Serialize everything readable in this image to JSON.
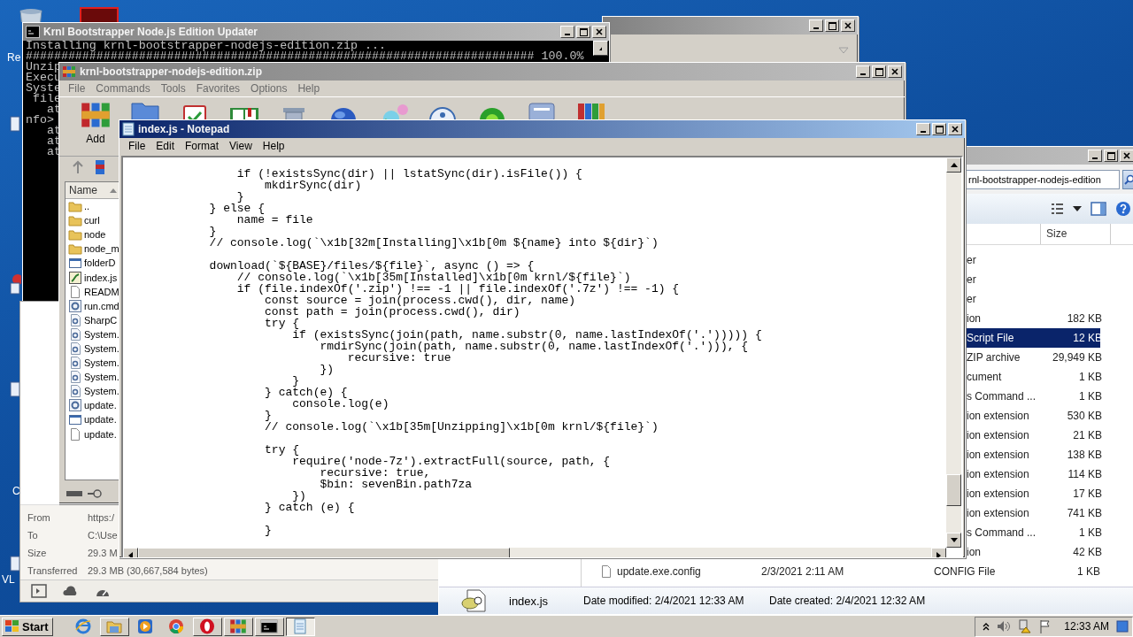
{
  "desktop": {
    "labels": [
      "Re",
      "C",
      "VL"
    ]
  },
  "console": {
    "title": "Krnl Bootstrapper Node.js Edition Updater",
    "lines": [
      "Installing krnl-bootstrapper-nodejs-edition.zip ...",
      "######################################################################## 100.0%",
      "Unzip",
      "Execu",
      "Syste",
      " file",
      "   at",
      "nfo>",
      "   at",
      "   at",
      "   at"
    ]
  },
  "download_panel": {
    "fields": [
      {
        "label": "From",
        "value": "https:/"
      },
      {
        "label": "To",
        "value": "C:\\Use"
      },
      {
        "label": "Size",
        "value": "29.3 M"
      },
      {
        "label": "Transferred",
        "value": "29.3 MB (30,667,584 bytes)"
      }
    ]
  },
  "explorer": {
    "address": "rnl-bootstrapper-nodejs-edition",
    "columns": [
      "Size"
    ],
    "rows": [
      {
        "kind": "partial",
        "type": "er",
        "selected": false
      },
      {
        "kind": "partial",
        "type": "er",
        "selected": false
      },
      {
        "kind": "partial",
        "type": "er",
        "selected": false
      },
      {
        "kind": "partial",
        "type": "ion",
        "size": "182 KB",
        "selected": false
      },
      {
        "kind": "partial",
        "type": "Script File",
        "size": "12 KB",
        "selected": true
      },
      {
        "kind": "partial",
        "type": "ZIP archive",
        "size": "29,949 KB",
        "selected": false
      },
      {
        "kind": "partial",
        "type": "cument",
        "size": "1 KB",
        "selected": false
      },
      {
        "kind": "partial",
        "type": "s Command ...",
        "size": "1 KB",
        "selected": false
      },
      {
        "kind": "partial",
        "type": "ion extension",
        "size": "530 KB",
        "selected": false
      },
      {
        "kind": "partial",
        "type": "ion extension",
        "size": "21 KB",
        "selected": false
      },
      {
        "kind": "partial",
        "type": "ion extension",
        "size": "138 KB",
        "selected": false
      },
      {
        "kind": "partial",
        "type": "ion extension",
        "size": "114 KB",
        "selected": false
      },
      {
        "kind": "partial",
        "type": "ion extension",
        "size": "17 KB",
        "selected": false
      },
      {
        "kind": "partial",
        "type": "ion extension",
        "size": "741 KB",
        "selected": false
      },
      {
        "kind": "partial",
        "type": "s Command ...",
        "size": "1 KB",
        "selected": false
      },
      {
        "kind": "partial",
        "type": "ion",
        "size": "42 KB",
        "selected": false
      },
      {
        "kind": "full",
        "name": "update.exe.config",
        "date": "2/3/2021 2:11 AM",
        "type": "CONFIG File",
        "size": "1 KB",
        "selected": false
      }
    ],
    "details": {
      "name": "index.js",
      "modified": "Date modified: 2/4/2021 12:33 AM",
      "created": "Date created: 2/4/2021 12:32 AM"
    }
  },
  "winrar": {
    "title": "krnl-bootstrapper-nodejs-edition.zip",
    "menu": [
      "File",
      "Commands",
      "Tools",
      "Favorites",
      "Options",
      "Help"
    ],
    "toolbar_label": "Add",
    "list_header": "Name",
    "files": [
      {
        "kind": "folder",
        "name": ".."
      },
      {
        "kind": "folder",
        "name": "curl"
      },
      {
        "kind": "folder",
        "name": "node"
      },
      {
        "kind": "folder",
        "name": "node_m"
      },
      {
        "kind": "app",
        "name": "folderD"
      },
      {
        "kind": "script",
        "name": "index.js"
      },
      {
        "kind": "text",
        "name": "READM"
      },
      {
        "kind": "cmd",
        "name": "run.cmd"
      },
      {
        "kind": "dll",
        "name": "SharpC"
      },
      {
        "kind": "dll",
        "name": "System."
      },
      {
        "kind": "dll",
        "name": "System."
      },
      {
        "kind": "dll",
        "name": "System."
      },
      {
        "kind": "dll",
        "name": "System."
      },
      {
        "kind": "dll",
        "name": "System."
      },
      {
        "kind": "cmd",
        "name": "update."
      },
      {
        "kind": "app",
        "name": "update."
      },
      {
        "kind": "text",
        "name": "update."
      }
    ]
  },
  "notepad": {
    "title": "index.js - Notepad",
    "menu": [
      "File",
      "Edit",
      "Format",
      "View",
      "Help"
    ],
    "blocks": [
      [
        "                if (!existsSync(dir) || lstatSync(dir).isFile()) {",
        "                    mkdirSync(dir)",
        "                }",
        "            } else {",
        "                name = file",
        "            }",
        "            // console.log(`\\x1b[32m[Installing]\\x1b[0m ${name} into ${dir}`)"
      ],
      [
        "            download(`${BASE}/files/${file}`, async () => {",
        "                // console.log(`\\x1b[35m[Installed]\\x1b[0m krnl/${file}`)",
        "                if (file.indexOf('.zip') !== -1 || file.indexOf('.7z') !== -1) {",
        "                    const source = join(process.cwd(), dir, name)",
        "                    const path = join(process.cwd(), dir)",
        "                    try {",
        "                        if (existsSync(join(path, name.substr(0, name.lastIndexOf('.'))))) {",
        "                            rmdirSync(join(path, name.substr(0, name.lastIndexOf('.'))), {",
        "                                recursive: true",
        "                            })",
        "                        }",
        "                    } catch(e) {",
        "                        console.log(e)",
        "                    }",
        "                    // console.log(`\\x1b[35m[Unzipping]\\x1b[0m krnl/${file}`)"
      ],
      [
        "                    try {",
        "                        require('node-7z').extractFull(source, path, {",
        "                            recursive: true,",
        "                            $bin: sevenBin.path7za",
        "                        })",
        "                    } catch (e) {"
      ],
      [
        "                    }"
      ]
    ]
  },
  "taskbar": {
    "start": "Start",
    "clock": "12:33 AM",
    "apps": [
      {
        "kind": "ie",
        "open": false,
        "selected": false
      },
      {
        "kind": "explorer",
        "open": true,
        "selected": false
      },
      {
        "kind": "media",
        "open": false,
        "selected": false
      },
      {
        "kind": "chrome",
        "open": false,
        "selected": false
      },
      {
        "kind": "opera",
        "open": true,
        "selected": false
      },
      {
        "kind": "winrar",
        "open": true,
        "selected": false
      },
      {
        "kind": "cmd",
        "open": true,
        "selected": false
      },
      {
        "kind": "notepad",
        "open": true,
        "selected": true
      }
    ]
  }
}
